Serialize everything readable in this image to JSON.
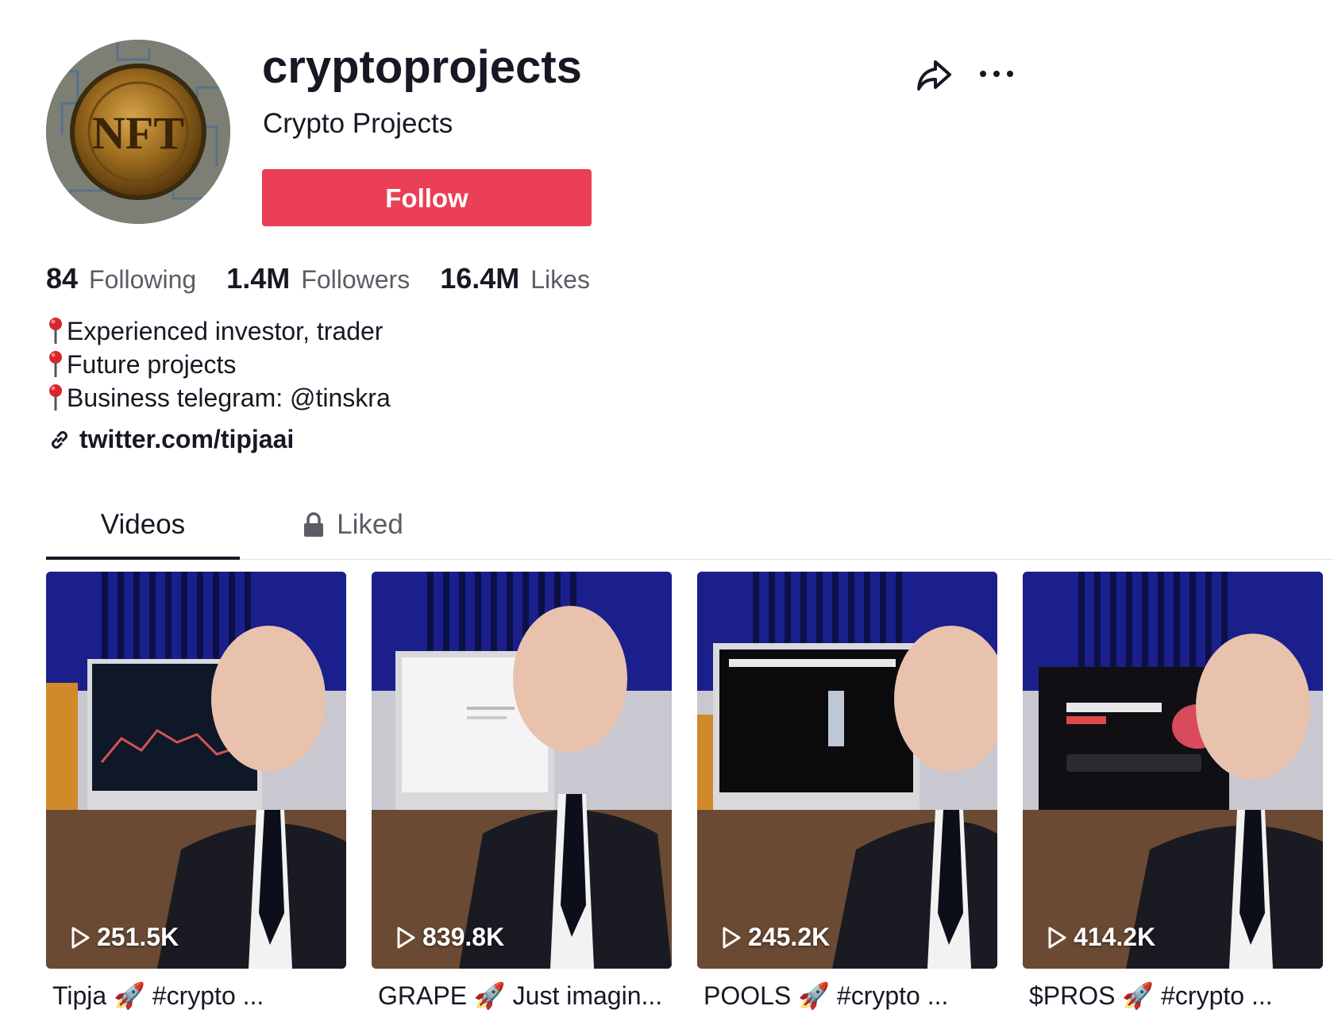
{
  "profile": {
    "username": "cryptoprojects",
    "nickname": "Crypto Projects",
    "follow_label": "Follow",
    "avatar_text": "NFT"
  },
  "stats": {
    "following_count": "84",
    "following_label": "Following",
    "followers_count": "1.4M",
    "followers_label": "Followers",
    "likes_count": "16.4M",
    "likes_label": "Likes"
  },
  "bio": {
    "lines": [
      "Experienced investor, trader",
      "Future projects",
      "Business telegram: @tinskra"
    ],
    "link": "twitter.com/tipjaai"
  },
  "tabs": [
    {
      "label": "Videos",
      "active": true
    },
    {
      "label": "Liked",
      "active": false,
      "locked": true
    }
  ],
  "videos": [
    {
      "views": "251.5K",
      "caption": "Tipja 🚀 #crypto ..."
    },
    {
      "views": "839.8K",
      "caption": "GRAPE 🚀 Just imagin..."
    },
    {
      "views": "245.2K",
      "caption": "POOLS 🚀 #crypto ..."
    },
    {
      "views": "414.2K",
      "caption": "$PROS 🚀 #crypto ..."
    }
  ],
  "icons": {
    "share": "share-icon",
    "more": "more-options-icon",
    "bio_bullet": "pushpin-icon",
    "link": "link-icon",
    "lock": "lock-icon",
    "play": "play-icon"
  },
  "colors": {
    "follow_button": "#ea3f57",
    "text_primary": "#161823",
    "text_secondary": "#5b5d64"
  }
}
